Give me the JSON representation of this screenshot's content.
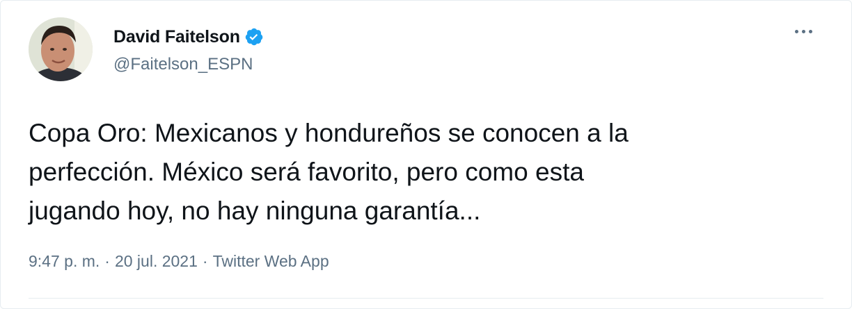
{
  "author": {
    "display_name": "David Faitelson",
    "handle": "@Faitelson_ESPN",
    "verified": true,
    "verified_color": "#1da1f2"
  },
  "tweet": {
    "text": "Copa Oro: Mexicanos y hondureños se conocen a la\nperfección. México será favorito, pero como esta\njugando hoy, no hay ninguna garantía..."
  },
  "meta": {
    "time": "9:47 p. m.",
    "separator": "·",
    "date": "20 jul. 2021",
    "source": "Twitter Web App"
  },
  "icons": {
    "more": "more-horizontal-icon",
    "verified": "verified-badge-icon"
  }
}
